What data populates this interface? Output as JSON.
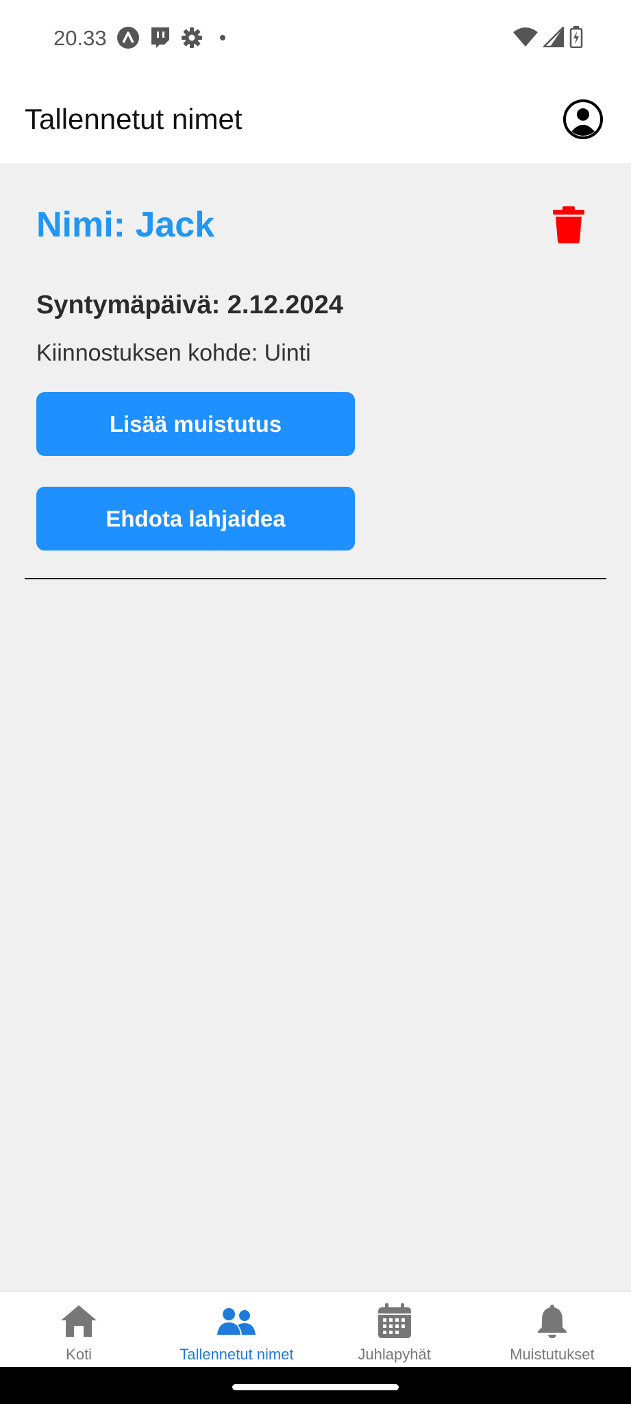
{
  "status_bar": {
    "time": "20.33",
    "left_icons": [
      "arrow-up-circle-icon",
      "twitch-icon",
      "gear-icon",
      "dot-icon"
    ],
    "right_icons": [
      "wifi-icon",
      "signal-icon",
      "battery-charging-icon"
    ]
  },
  "header": {
    "title": "Tallennetut nimet",
    "profile_icon": "account-circle-icon"
  },
  "person": {
    "name": "Nimi: Jack",
    "birthday": "Syntymäpäivä: 2.12.2024",
    "interest": "Kiinnostuksen kohde: Uinti",
    "add_reminder_label": "Lisää muistutus",
    "suggest_gift_label": "Ehdota lahjaidea",
    "delete_icon": "trash-icon"
  },
  "bottom_nav": {
    "items": [
      {
        "label": "Koti",
        "icon": "home-icon"
      },
      {
        "label": "Tallennetut nimet",
        "icon": "people-icon",
        "active": true
      },
      {
        "label": "Juhlapyhät",
        "icon": "calendar-icon"
      },
      {
        "label": "Muistutukset",
        "icon": "bell-icon"
      }
    ]
  },
  "colors": {
    "accent": "#2196f3",
    "button": "#1e90ff",
    "delete": "#ff0000",
    "active_nav": "#1e7bdc",
    "inactive_nav": "#777777",
    "background": "#f0f0f0"
  }
}
